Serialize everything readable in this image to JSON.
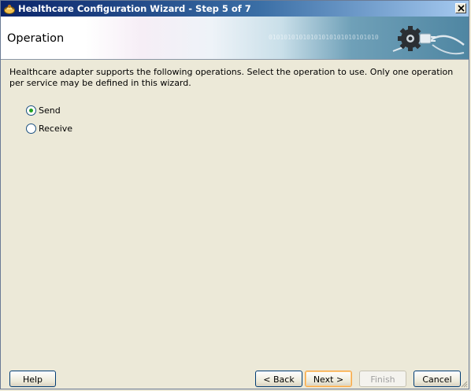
{
  "window": {
    "title": "Healthcare Configuration Wizard - Step 5 of 7",
    "close_label": "×"
  },
  "banner": {
    "title": "Operation",
    "binary_text": "0101010101010101010101010101010101010101010101010101010101010101"
  },
  "description": "Healthcare adapter supports the following operations.  Select the operation to use.  Only one operation per service may be defined in this wizard.",
  "operations": [
    {
      "label": "Send",
      "selected": true
    },
    {
      "label": "Receive",
      "selected": false
    }
  ],
  "buttons": {
    "help": "Help",
    "back": "< Back",
    "next": "Next >",
    "finish": "Finish",
    "cancel": "Cancel"
  },
  "colors": {
    "title_bar": "#0a246a",
    "face": "#ece9d8",
    "radio_dot": "#21a121",
    "default_button_border": "#f5a64a"
  },
  "icons": {
    "title": "wizard-app-icon",
    "banner": "gear-plug-icon",
    "close": "close-icon"
  }
}
